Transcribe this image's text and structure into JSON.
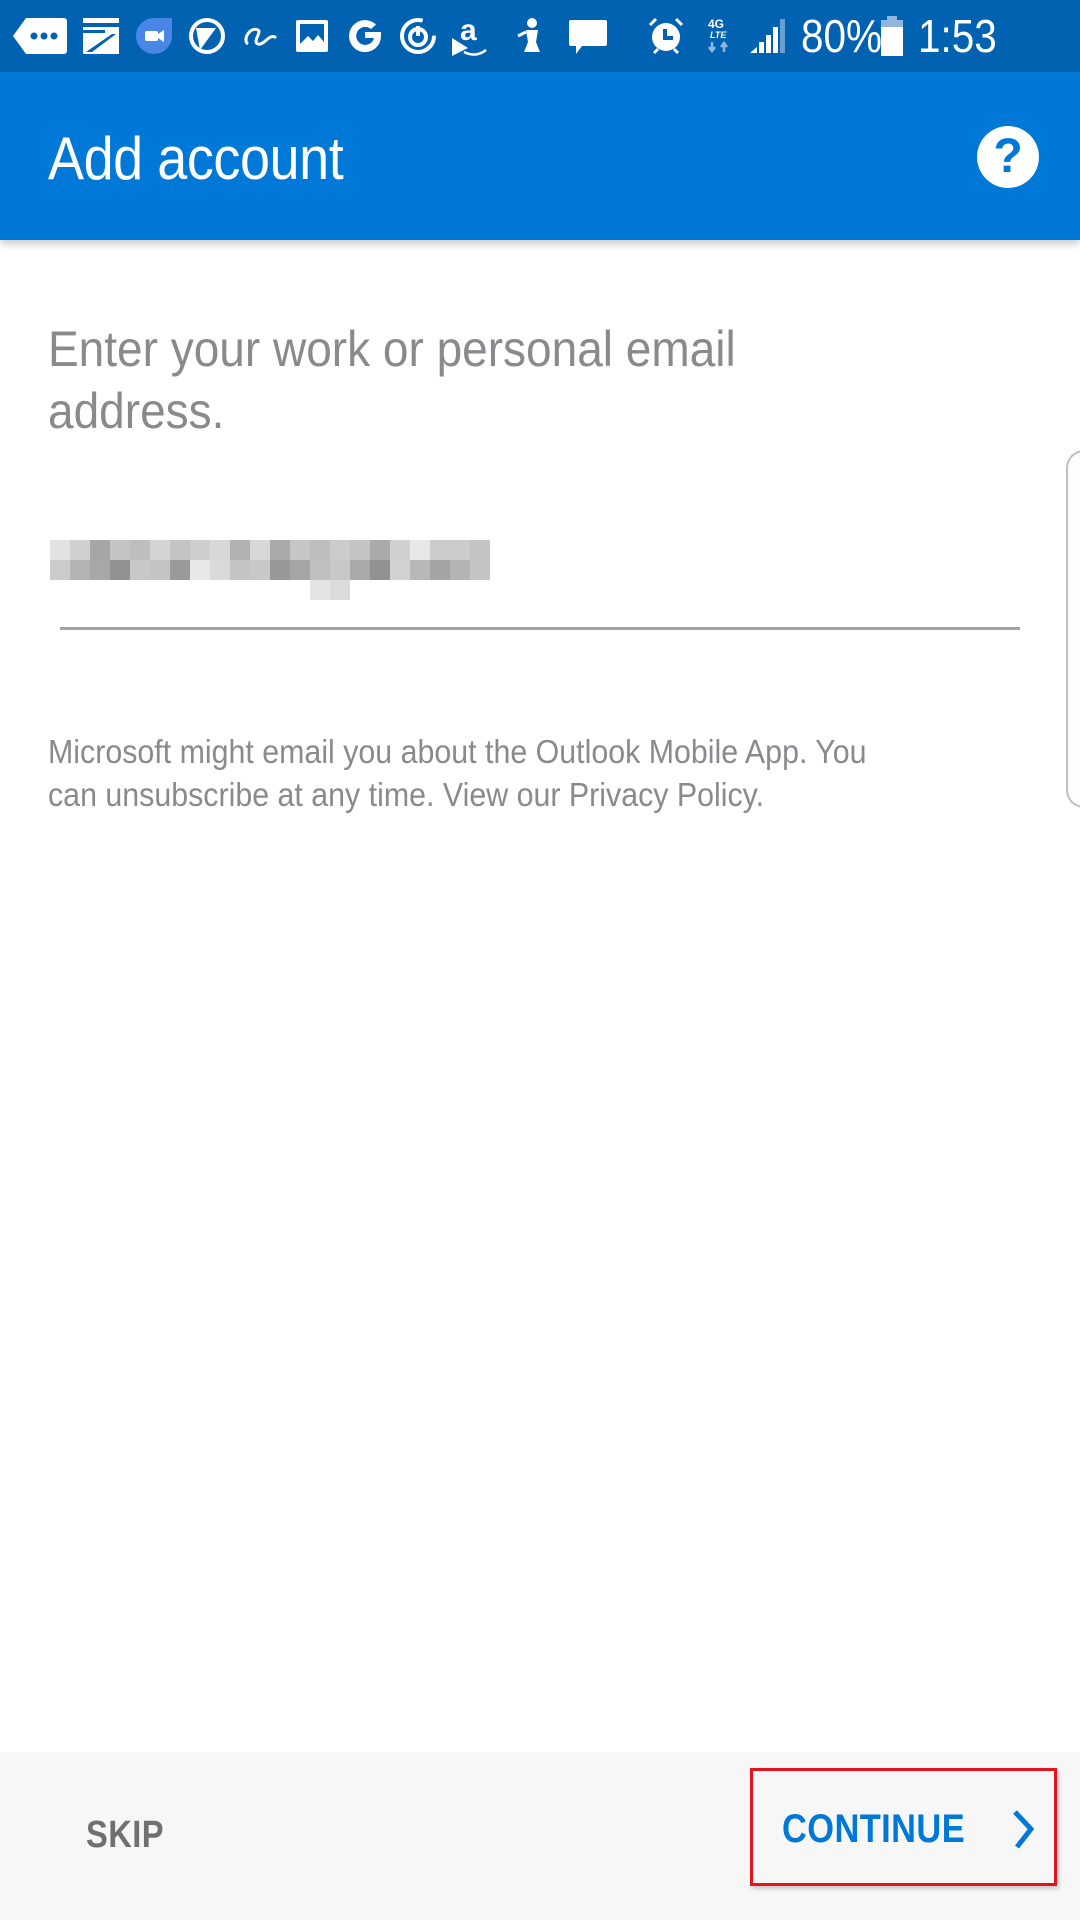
{
  "status_bar": {
    "notification_icons": [
      "more-notifications-icon",
      "cast-screen-icon",
      "google-duo-icon",
      "app-circle-icon",
      "alibaba-icon",
      "gallery-icon",
      "google-icon",
      "power-app-icon",
      "amazon-icon",
      "fitness-icon",
      "message-icon"
    ],
    "system_icons": [
      "alarm-icon",
      "4g-lte-icon",
      "signal-icon",
      "battery-icon"
    ],
    "network_label": "4G LTE",
    "battery_percent": "80%",
    "battery_level": 0.8,
    "time": "1:53 PM"
  },
  "app_bar": {
    "title": "Add account",
    "help_icon": "help-icon",
    "help_glyph": "?"
  },
  "form": {
    "heading": "Enter your work or personal email address.",
    "email_value_redacted": true,
    "disclaimer_text": "Microsoft might email you about the Outlook Mobile App. You can unsubscribe at any time. View our ",
    "privacy_link": "Privacy Policy",
    "disclaimer_end": "."
  },
  "footer": {
    "skip_label": "SKIP",
    "continue_label": "CONTINUE",
    "continue_icon": "chevron-right-icon"
  },
  "colors": {
    "status_bar": "#0062b0",
    "app_bar": "#0078d7",
    "accent": "#0078d7",
    "text_gray": "#8a8a8e",
    "footer_bg": "#f7f7f7",
    "highlight_box": "#e3141c"
  }
}
